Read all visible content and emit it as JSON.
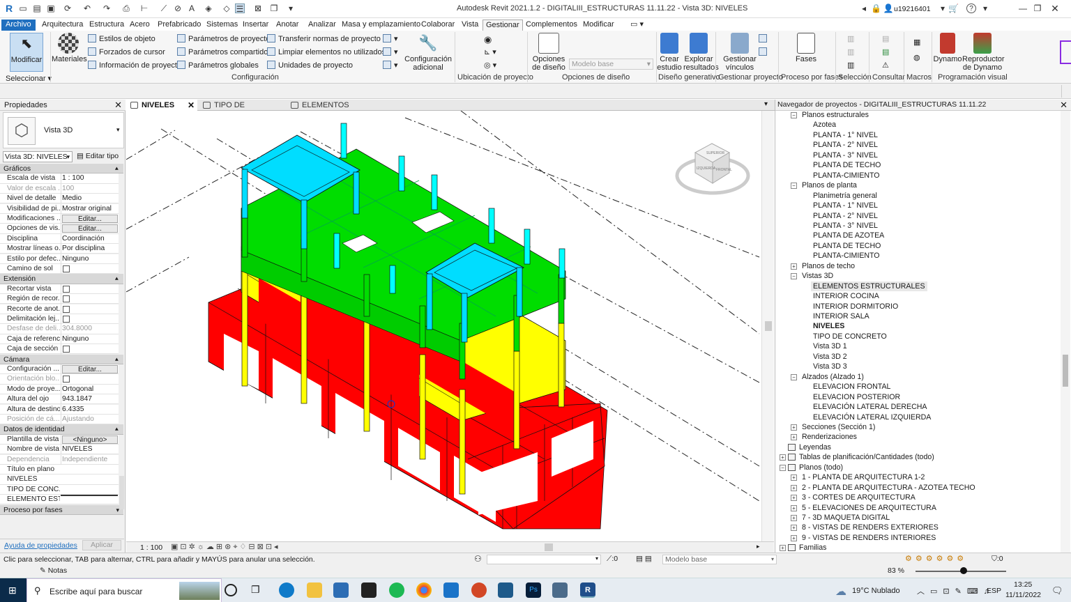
{
  "app": {
    "title": "Autodesk Revit 2021.1.2 - DIGITALIII_ESTRUCTURAS 11.11.22 - Vista 3D: NIVELES",
    "user": "u19216401"
  },
  "menu": [
    "Archivo",
    "Arquitectura",
    "Estructura",
    "Acero",
    "Prefabricado",
    "Sistemas",
    "Insertar",
    "Anotar",
    "Analizar",
    "Masa y emplazamiento",
    "Colaborar",
    "Vista",
    "Gestionar",
    "Complementos",
    "Modificar"
  ],
  "ribbon": {
    "modify": "Modificar",
    "materials": "Materiales",
    "select": "Seleccionar",
    "settings_small": [
      "Estilos de objeto",
      "Forzados de cursor",
      "Información de proyecto",
      "Parámetros de proyecto",
      "Parámetros compartidos",
      "Parámetros  globales",
      "Transferir normas de proyecto",
      "Limpiar elementos no utilizados",
      "Unidades de proyecto"
    ],
    "additional": "Configuración adicional",
    "design_options": "Opciones de diseño",
    "base_model": "Modelo base",
    "create_study": "Crear estudio",
    "explore_results": "Explorar resultados",
    "manage_links": "Gestionar vínculos",
    "phases": "Fases",
    "dynamo": "Dynamo",
    "dynamo_player": "Reproductor de Dynamo",
    "panels": [
      "Configuración",
      "Ubicación de proyecto",
      "Opciones de diseño",
      "Diseño generativo",
      "Gestionar proyecto",
      "Proceso por fases",
      "Selección",
      "Consultar",
      "Macros",
      "Programación visual"
    ]
  },
  "properties": {
    "title": "Propiedades",
    "type_name": "Vista 3D",
    "view_selector": "Vista 3D: NIVELES",
    "edit_type": "Editar tipo",
    "sections": {
      "graphics": "Gráficos",
      "extent": "Extensión",
      "camera": "Cámara",
      "identity": "Datos de identidad",
      "phasing": "Proceso por fases"
    },
    "graphics": [
      [
        "Escala de vista",
        "1 : 100"
      ],
      [
        "Valor de escala ...",
        "100"
      ],
      [
        "Nivel de detalle",
        "Medio"
      ],
      [
        "Visibilidad de pi...",
        "Mostrar original"
      ],
      [
        "Modificaciones ...",
        "Editar..."
      ],
      [
        "Opciones de vis...",
        "Editar..."
      ],
      [
        "Disciplina",
        "Coordinación"
      ],
      [
        "Mostrar líneas o...",
        "Por disciplina"
      ],
      [
        "Estilo por defec...",
        "Ninguno"
      ],
      [
        "Camino de sol",
        ""
      ]
    ],
    "extent": [
      [
        "Recortar vista",
        ""
      ],
      [
        "Región de recor...",
        ""
      ],
      [
        "Recorte de anot...",
        ""
      ],
      [
        "Delimitación lej...",
        ""
      ],
      [
        "Desfase de deli...",
        "304.8000"
      ],
      [
        "Caja de referencia",
        "Ninguno"
      ],
      [
        "Caja de sección",
        ""
      ]
    ],
    "camera": [
      [
        "Configuración ...",
        "Editar..."
      ],
      [
        "Orientación blo...",
        ""
      ],
      [
        "Modo de proye...",
        "Ortogonal"
      ],
      [
        "Altura del ojo",
        "943.1847"
      ],
      [
        "Altura de destino",
        "6.4335"
      ],
      [
        "Posición de cá...",
        "Ajustando"
      ]
    ],
    "identity": [
      [
        "Plantilla de vista",
        "<Ninguno>"
      ],
      [
        "Nombre de vista",
        "NIVELES"
      ],
      [
        "Dependencia",
        "Independiente"
      ],
      [
        "Título en plano",
        ""
      ],
      [
        "NIVELES",
        ""
      ],
      [
        "TIPO DE CONC...",
        ""
      ],
      [
        "ELEMENTO EST...",
        ""
      ]
    ],
    "help_link": "Ayuda de propiedades",
    "apply": "Aplicar"
  },
  "tabs": [
    "NIVELES",
    "TIPO DE CONCRETO",
    "ELEMENTOS ESTRUCTURALES"
  ],
  "viewcube": {
    "top": "SUPERIOR",
    "front": "FRONTAL",
    "left": "IZQUIERDA"
  },
  "view_scale": "1 : 100",
  "browser": {
    "title": "Navegador de proyectos - DIGITALIII_ESTRUCTURAS 11.11.22",
    "items": [
      {
        "t": "Planos estructurales",
        "lvl": 1,
        "tog": "-"
      },
      {
        "t": "Azotea",
        "lvl": 2
      },
      {
        "t": "PLANTA - 1° NIVEL",
        "lvl": 2
      },
      {
        "t": "PLANTA - 2° NIVEL",
        "lvl": 2
      },
      {
        "t": "PLANTA - 3° NIVEL",
        "lvl": 2
      },
      {
        "t": "PLANTA DE TECHO",
        "lvl": 2
      },
      {
        "t": "PLANTA-CIMIENTO",
        "lvl": 2
      },
      {
        "t": "Planos de planta",
        "lvl": 1,
        "tog": "-"
      },
      {
        "t": "Planimetría general",
        "lvl": 2
      },
      {
        "t": "PLANTA - 1° NIVEL",
        "lvl": 2
      },
      {
        "t": "PLANTA - 2° NIVEL",
        "lvl": 2
      },
      {
        "t": "PLANTA - 3° NIVEL",
        "lvl": 2
      },
      {
        "t": "PLANTA DE AZOTEA",
        "lvl": 2
      },
      {
        "t": "PLANTA DE TECHO",
        "lvl": 2
      },
      {
        "t": "PLANTA-CIMIENTO",
        "lvl": 2
      },
      {
        "t": "Planos de techo",
        "lvl": 1,
        "tog": "+"
      },
      {
        "t": "Vistas 3D",
        "lvl": 1,
        "tog": "-"
      },
      {
        "t": "ELEMENTOS ESTRUCTURALES",
        "lvl": 2,
        "hl": true
      },
      {
        "t": "INTERIOR COCINA",
        "lvl": 2
      },
      {
        "t": "INTERIOR DORMITORIO",
        "lvl": 2
      },
      {
        "t": "INTERIOR SALA",
        "lvl": 2
      },
      {
        "t": "NIVELES",
        "lvl": 2,
        "bold": true
      },
      {
        "t": "TIPO DE CONCRETO",
        "lvl": 2
      },
      {
        "t": "Vista 3D 1",
        "lvl": 2
      },
      {
        "t": "Vista 3D 2",
        "lvl": 2
      },
      {
        "t": "Vista 3D 3",
        "lvl": 2
      },
      {
        "t": "Alzados (Alzado 1)",
        "lvl": 1,
        "tog": "-"
      },
      {
        "t": "ELEVACION FRONTAL",
        "lvl": 2
      },
      {
        "t": "ELEVACION POSTERIOR",
        "lvl": 2
      },
      {
        "t": "ELEVACIÓN LATERAL DERECHA",
        "lvl": 2
      },
      {
        "t": "ELEVACIÓN LATERAL IZQUIERDA",
        "lvl": 2
      },
      {
        "t": "Secciones (Sección 1)",
        "lvl": 1,
        "tog": "+"
      },
      {
        "t": "Renderizaciones",
        "lvl": 1,
        "tog": "+"
      },
      {
        "t": "Leyendas",
        "lvl": 0,
        "ico": true
      },
      {
        "t": "Tablas de planificación/Cantidades (todo)",
        "lvl": 0,
        "ico": true,
        "tog": "+"
      },
      {
        "t": "Planos (todo)",
        "lvl": 0,
        "ico": true,
        "tog": "-"
      },
      {
        "t": "1 - PLANTA DE ARQUITECTURA 1-2",
        "lvl": 1,
        "tog": "+"
      },
      {
        "t": "2 - PLANTA DE ARQUITECTURA - AZOTEA TECHO",
        "lvl": 1,
        "tog": "+"
      },
      {
        "t": "3 - CORTES DE ARQUITECTURA",
        "lvl": 1,
        "tog": "+"
      },
      {
        "t": "5 - ELEVACIONES DE ARQUITECTURA",
        "lvl": 1,
        "tog": "+"
      },
      {
        "t": "7 - 3D MAQUETA DIGITAL",
        "lvl": 1,
        "tog": "+"
      },
      {
        "t": "8 - VISTAS DE RENDERS EXTERIORES",
        "lvl": 1,
        "tog": "+"
      },
      {
        "t": "9 - VISTAS DE RENDERS INTERIORES",
        "lvl": 1,
        "tog": "+"
      },
      {
        "t": "Familias",
        "lvl": 0,
        "ico": true,
        "tog": "+"
      }
    ]
  },
  "status": {
    "hint": "Clic para seleccionar, TAB para alternar, CTRL para añadir y MAYÚS para anular una selección.",
    "zero": ":0",
    "model": "Modelo base",
    "filter": ":0",
    "notes": "Notas",
    "zoom": "83 %"
  },
  "taskbar": {
    "search": "Escribe aquí para buscar",
    "weather": "19°C  Nublado",
    "lang": "ESP",
    "time": "13:25",
    "date": "11/11/2022"
  },
  "colors": {
    "accent": "#1f6fbf",
    "level1": "#ff0000",
    "level2": "#ffff00",
    "level3": "#00dd00",
    "roof": "#00ddff"
  }
}
